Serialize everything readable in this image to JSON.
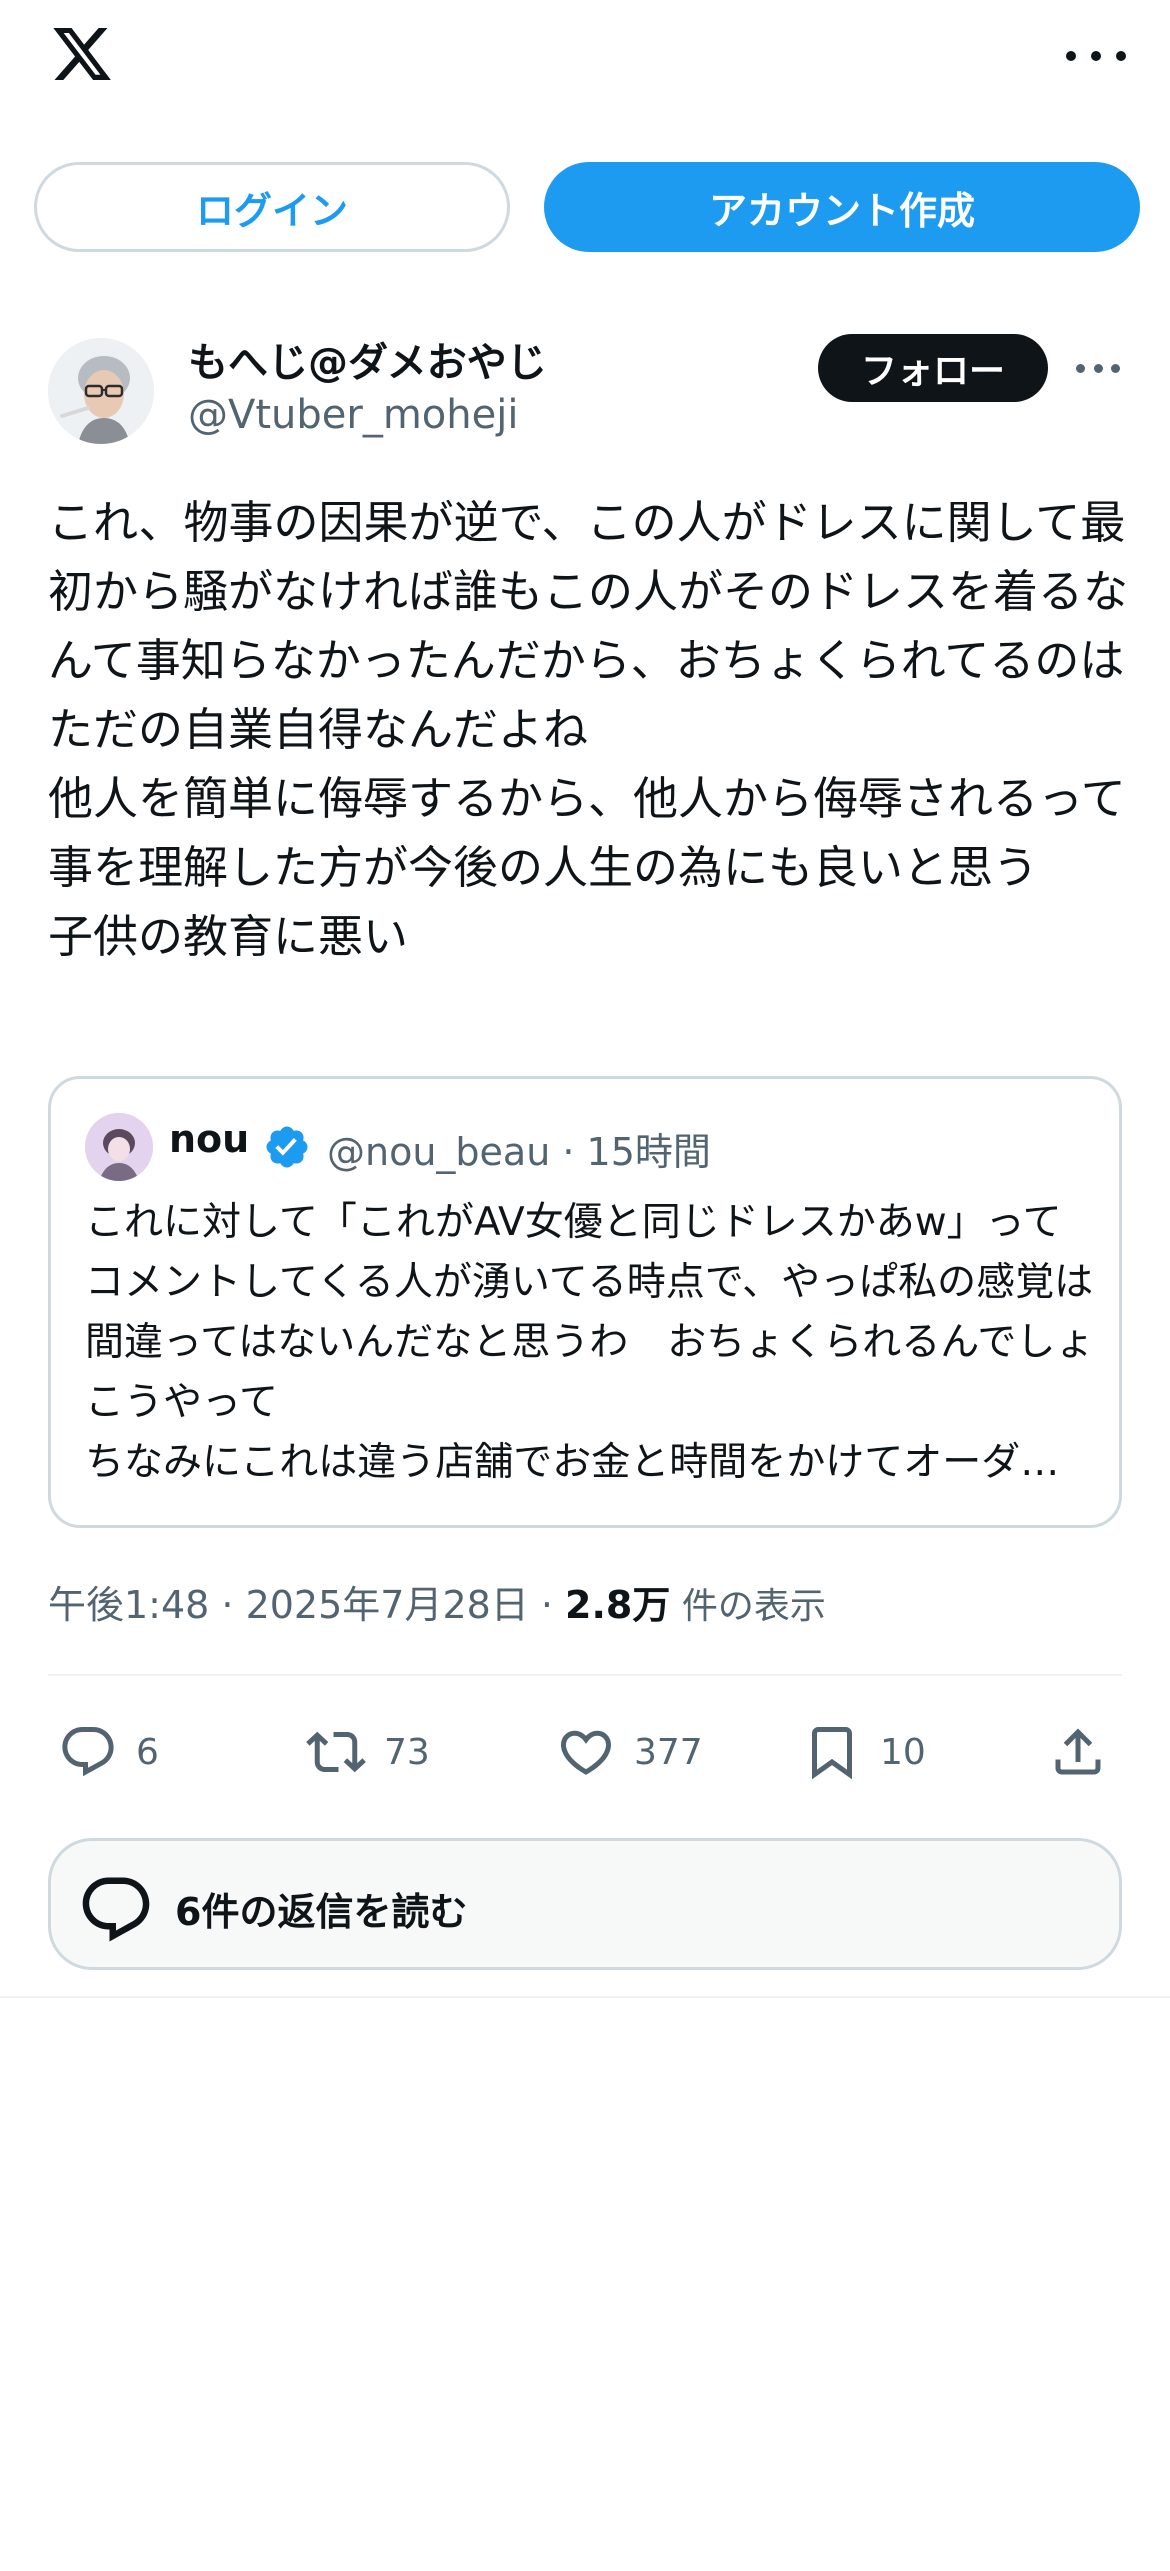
{
  "header": {
    "logo": "x-logo-icon",
    "more_icon": "more-horizontal-icon"
  },
  "auth": {
    "login_label": "ログイン",
    "signup_label": "アカウント作成"
  },
  "post": {
    "display_name": "もへじ@ダメおやじ",
    "handle": "@Vtuber_moheji",
    "follow_label": "フォロー",
    "text": "これ、物事の因果が逆で、この人がドレスに関して最初から騒がなければ誰もこの人がそのドレスを着るなんて事知らなかったんだから、おちょくられてるのはただの自業自得なんだよね\n他人を簡単に侮辱するから、他人から侮辱されるって事を理解した方が今後の人生の為にも良いと思う\n子供の教育に悪い"
  },
  "quote": {
    "name": "nou",
    "meta": "@nou_beau · 15時間",
    "text": "これに対して「これがAV女優と同じドレスかあw」ってコメントしてくる人が湧いてる時点で、やっぱ私の感覚は間違ってはないんだなと思うわ　おちょくられるんでしょこうやって",
    "text_last": "ちなみにこれは違う店舗でお金と時間をかけてオーダーメイドしたドレスです"
  },
  "meta": {
    "time_date": "午後1:48 · 2025年7月28日 · ",
    "views_count": "2.8万",
    "views_label": " 件の表示"
  },
  "actions": {
    "reply_count": "6",
    "retweet_count": "73",
    "like_count": "377",
    "bookmark_count": "10"
  },
  "replies": {
    "label": "6件の返信を読む"
  },
  "colors": {
    "accent": "#1d9bf0",
    "text": "#0f1419",
    "muted": "#536471",
    "border": "#cfd9de"
  }
}
